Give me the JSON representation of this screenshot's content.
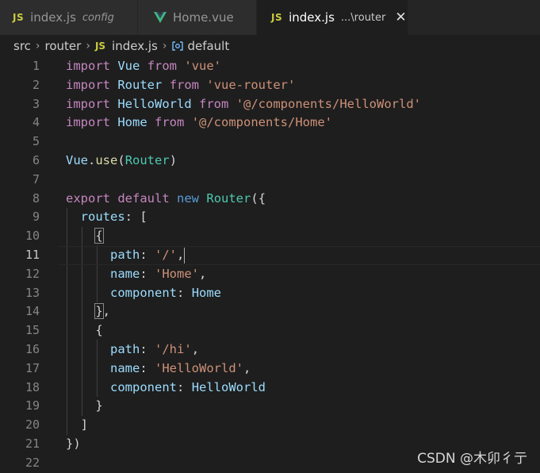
{
  "tabs": [
    {
      "icon": "JS",
      "name": "index.js",
      "sub": "config"
    },
    {
      "icon": "vue-logo-icon",
      "name": "Home.vue",
      "sub": ""
    },
    {
      "icon": "JS",
      "name": "index.js",
      "sub": "...\\router",
      "close": "✕"
    }
  ],
  "breadcrumb": {
    "items": [
      "src",
      "router",
      "index.js",
      "default"
    ],
    "js_icon": "JS",
    "separator": "›"
  },
  "editor": {
    "current_line": 11,
    "line_numbers": [
      "1",
      "2",
      "3",
      "4",
      "5",
      "6",
      "7",
      "8",
      "9",
      "10",
      "11",
      "12",
      "13",
      "14",
      "15",
      "16",
      "17",
      "18",
      "19",
      "20",
      "21",
      "22"
    ],
    "code": [
      "import Vue from 'vue'",
      "import Router from 'vue-router'",
      "import HelloWorld from '@/components/HelloWorld'",
      "import Home from '@/components/Home'",
      "",
      "Vue.use(Router)",
      "",
      "export default new Router({",
      "  routes: [",
      "    {",
      "      path: '/',",
      "      name: 'Home',",
      "      component: Home",
      "    },",
      "    {",
      "      path: '/hi',",
      "      name: 'HelloWorld',",
      "      component: HelloWorld",
      "    }",
      "  ]",
      "})",
      ""
    ]
  },
  "watermark": "CSDN @木卯彳亍",
  "colors": {
    "keyword": "#c586c0",
    "string": "#ce9178",
    "variable": "#9cdcfe",
    "class": "#4ec9b0",
    "function": "#dcdcaa",
    "storage": "#569cd6"
  }
}
